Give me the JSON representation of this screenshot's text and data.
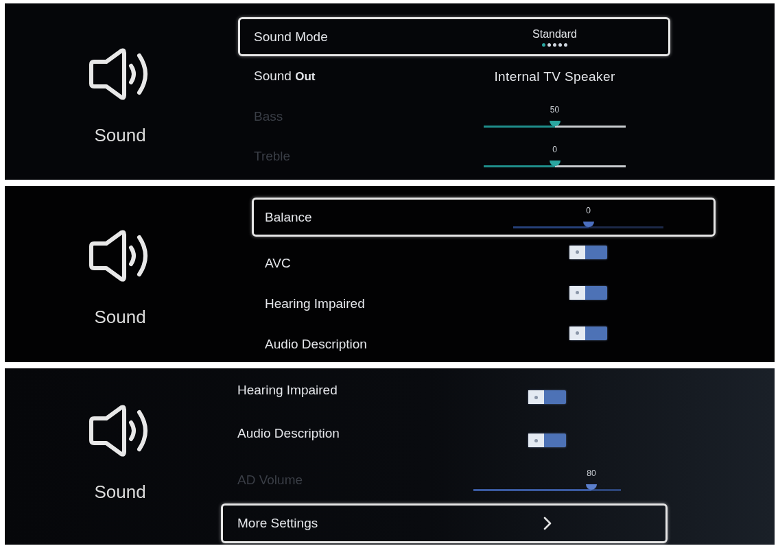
{
  "panels": [
    {
      "category": {
        "label": "Sound"
      },
      "rows": [
        {
          "kind": "choice",
          "label": "Sound Mode",
          "value": "Standard",
          "dots": [
            {
              "selected": true
            },
            {
              "selected": false
            },
            {
              "selected": false
            },
            {
              "selected": false
            },
            {
              "selected": false
            }
          ],
          "selected": true,
          "disabled": false
        },
        {
          "kind": "choice",
          "label": "Sound **Out**",
          "value": "Internal TV Speaker",
          "selected": false,
          "disabled": false
        },
        {
          "kind": "slider",
          "label": "Bass",
          "reading": "50",
          "level": 0.5,
          "selected": false,
          "disabled": true
        },
        {
          "kind": "slider",
          "label": "Treble",
          "reading": "0",
          "level": 0.5,
          "selected": false,
          "disabled": true
        }
      ]
    },
    {
      "category": {
        "label": "Sound"
      },
      "rows": [
        {
          "kind": "slider",
          "label": "Balance",
          "reading": "0",
          "level": 0.5,
          "selected": true,
          "disabled": false
        },
        {
          "kind": "toggle",
          "label": "AVC",
          "on": false,
          "selected": false,
          "disabled": false
        },
        {
          "kind": "toggle",
          "label": "Hearing Impaired",
          "on": false,
          "selected": false,
          "disabled": false
        },
        {
          "kind": "toggle",
          "label": "Audio Description",
          "on": false,
          "selected": false,
          "disabled": false
        }
      ]
    },
    {
      "category": {
        "label": "Sound"
      },
      "rows": [
        {
          "kind": "toggle",
          "label": "Hearing Impaired",
          "on": false,
          "selected": false,
          "disabled": false
        },
        {
          "kind": "toggle",
          "label": "Audio Description",
          "on": false,
          "selected": false,
          "disabled": false
        },
        {
          "kind": "slider",
          "label": "AD Volume",
          "reading": "80",
          "level": 0.8,
          "selected": false,
          "disabled": true
        },
        {
          "kind": "link",
          "label": "More Settings",
          "selected": true,
          "disabled": false
        }
      ]
    }
  ]
}
